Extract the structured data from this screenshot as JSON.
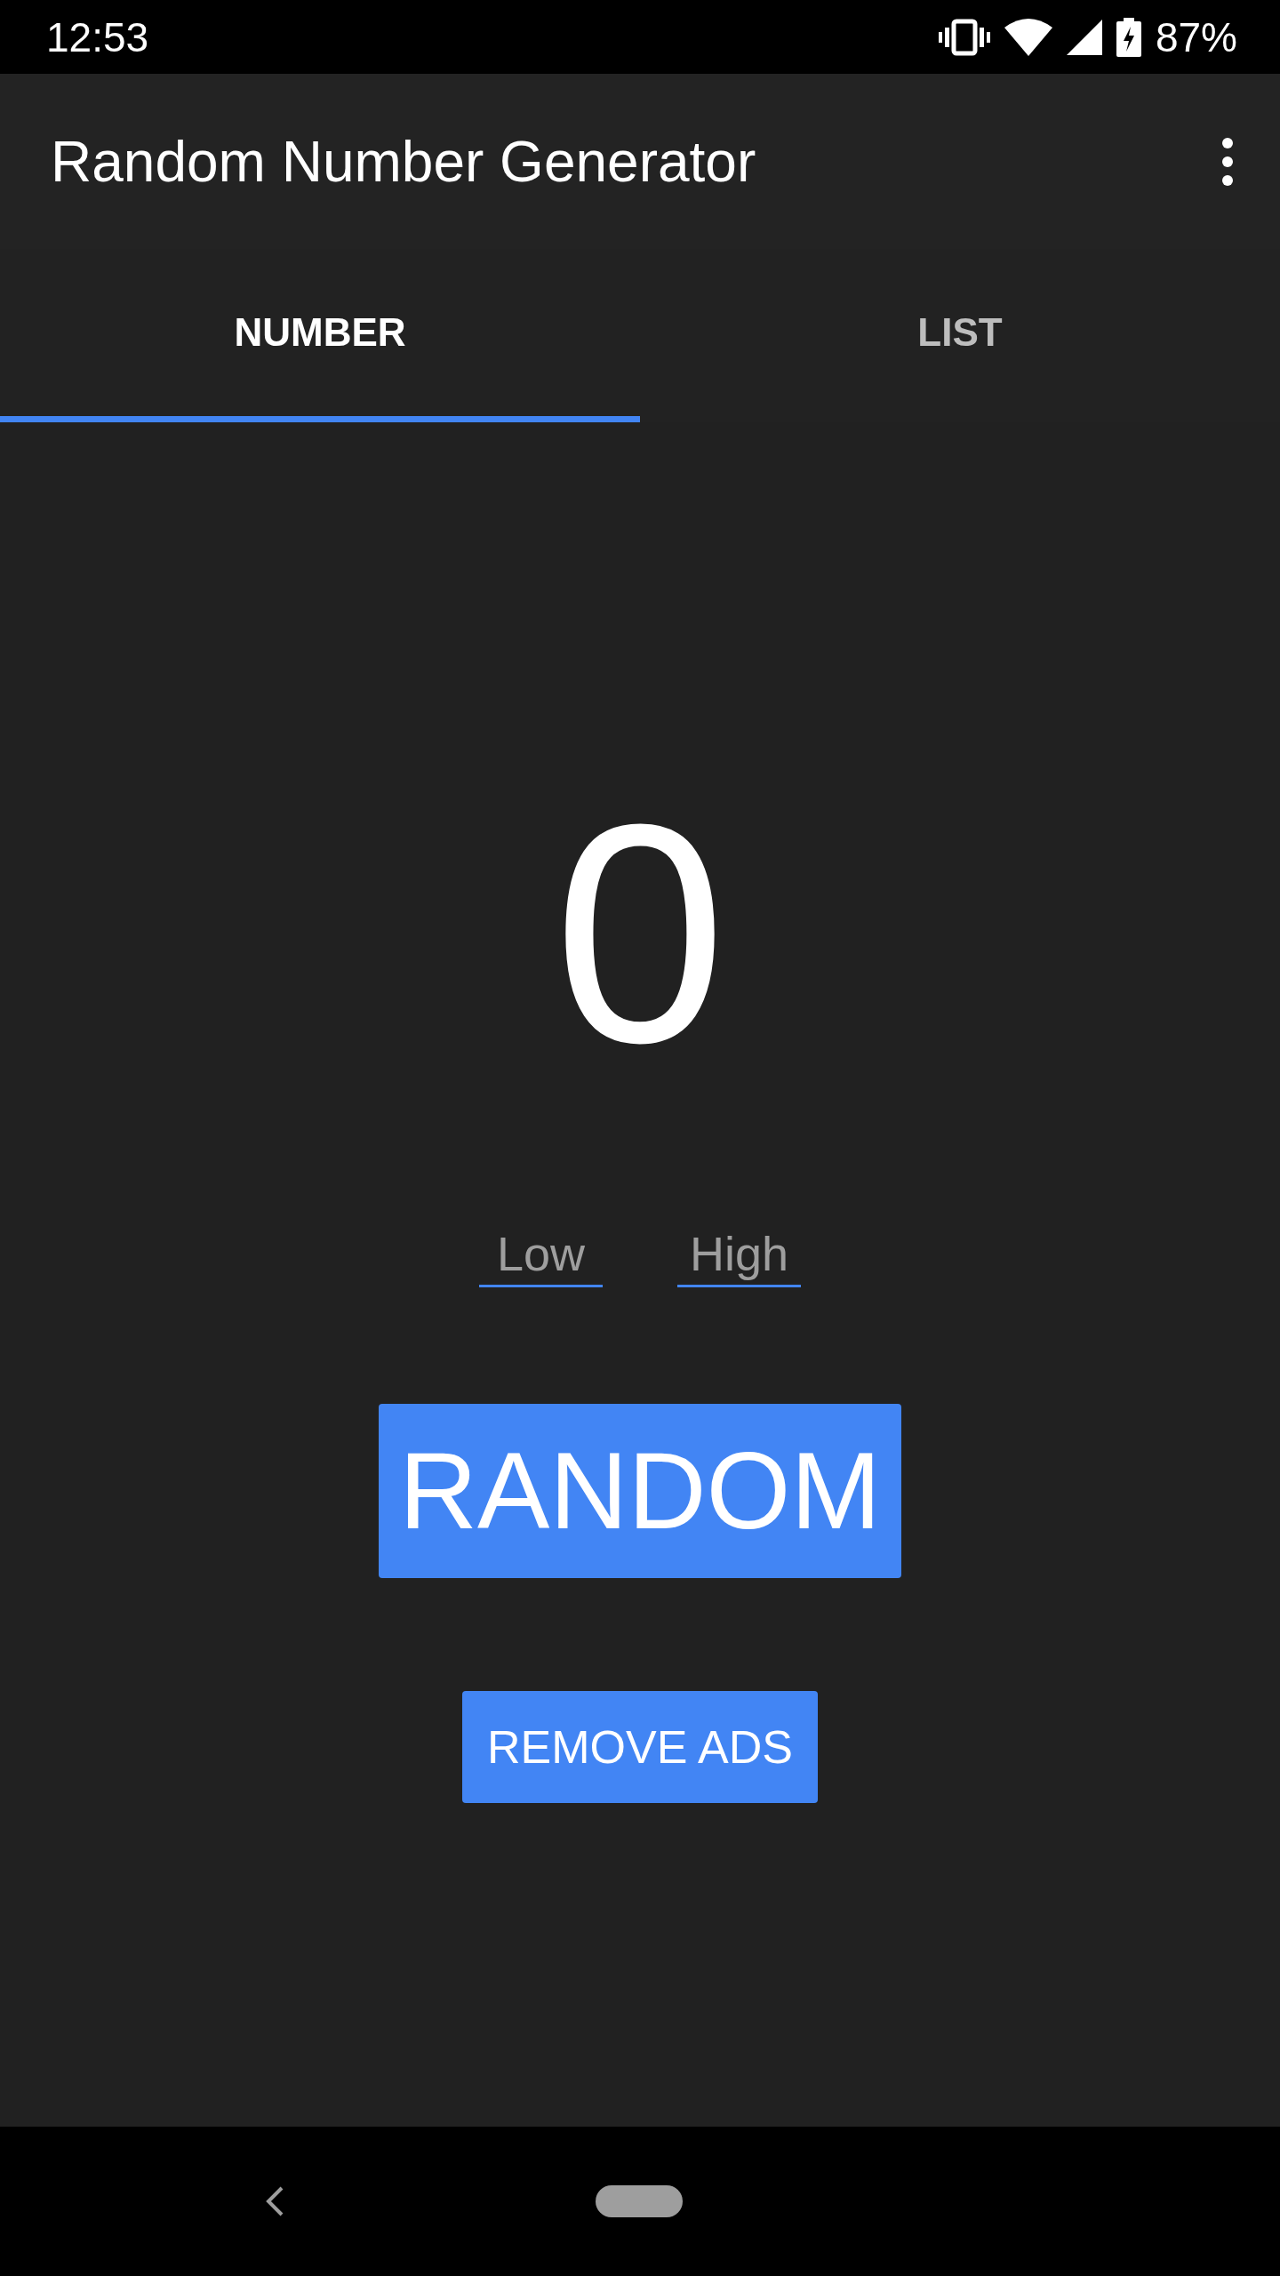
{
  "status_bar": {
    "time": "12:53",
    "battery": "87%"
  },
  "app_bar": {
    "title": "Random Number Generator"
  },
  "tabs": [
    {
      "label": "NUMBER",
      "selected": true
    },
    {
      "label": "LIST",
      "selected": false
    }
  ],
  "result": "0",
  "range_fields": [
    {
      "placeholder": "Low"
    },
    {
      "placeholder": "High"
    }
  ],
  "random_button": "RANDOM",
  "remove_ads_button": "REMOVE ADS"
}
